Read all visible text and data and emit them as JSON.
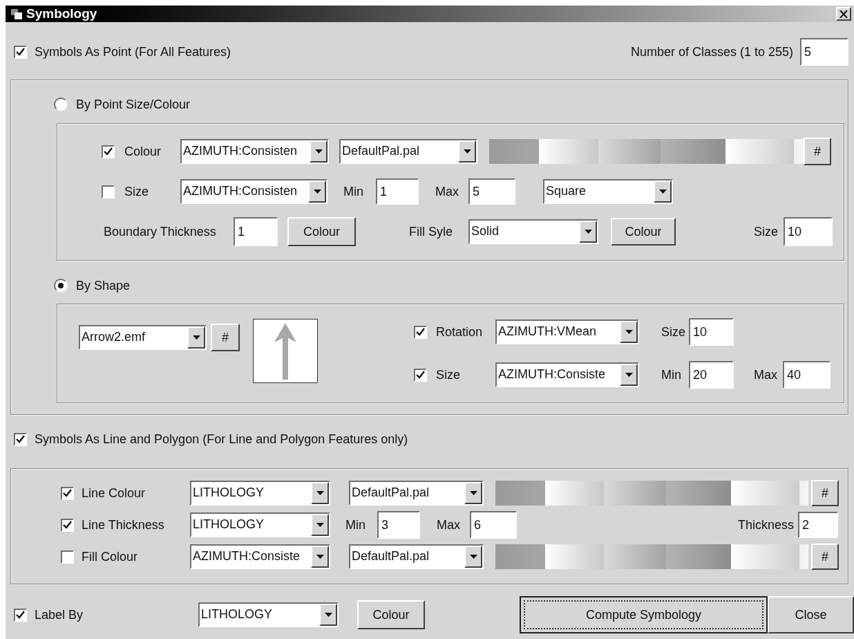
{
  "window": {
    "title": "Symbology"
  },
  "point_symbols": {
    "label": "Symbols As Point (For All Features)",
    "checked": true
  },
  "classes": {
    "label": "Number of Classes (1 to 255)",
    "value": "5"
  },
  "point_modes": [
    {
      "label": "By Point Size/Colour",
      "selected": false
    },
    {
      "label": "By Shape",
      "selected": true
    }
  ],
  "size_colour": {
    "colour": {
      "label": "Colour",
      "checked": true,
      "field": "AZIMUTH:Consisten",
      "palette": "DefaultPal.pal",
      "palette_button": "#"
    },
    "size": {
      "label": "Size",
      "checked": false,
      "field": "AZIMUTH:Consisten",
      "min_label": "Min",
      "min": "1",
      "max_label": "Max",
      "max": "5",
      "shape": "Square"
    },
    "boundary": {
      "label": "Boundary Thickness",
      "value": "1",
      "colour_button": "Colour",
      "fill_label": "Fill Syle",
      "fill_style": "Solid",
      "fill_colour_button": "Colour",
      "size_label": "Size",
      "size": "10"
    }
  },
  "shape": {
    "symbol": "Arrow2.emf",
    "symbol_button": "#",
    "rotation": {
      "label": "Rotation",
      "checked": true,
      "field": "AZIMUTH:VMean",
      "size_label": "Size",
      "size": "10"
    },
    "size": {
      "label": "Size",
      "checked": true,
      "field": "AZIMUTH:Consiste",
      "min_label": "Min",
      "min": "20",
      "max_label": "Max",
      "max": "40"
    }
  },
  "line_polygon": {
    "label": "Symbols As Line and Polygon (For Line and Polygon Features only)",
    "checked": true
  },
  "line_rows": [
    {
      "kind": "palette",
      "label": "Line Colour",
      "checked": true,
      "field": "LITHOLOGY",
      "palette": "DefaultPal.pal",
      "palette_button": "#"
    },
    {
      "kind": "range",
      "label": "Line Thickness",
      "checked": true,
      "field": "LITHOLOGY",
      "min_label": "Min",
      "min": "3",
      "max_label": "Max",
      "max": "6",
      "thickness_label": "Thickness",
      "thickness": "2"
    },
    {
      "kind": "palette",
      "label": "Fill Colour",
      "checked": false,
      "field": "AZIMUTH:Consiste",
      "palette": "DefaultPal.pal",
      "palette_button": "#"
    }
  ],
  "label_by": {
    "label": "Label By",
    "checked": true,
    "field": "LITHOLOGY",
    "colour_button": "Colour"
  },
  "buttons": [
    {
      "label": "Compute Symbology",
      "default": true
    },
    {
      "label": "Close",
      "default": false
    }
  ]
}
